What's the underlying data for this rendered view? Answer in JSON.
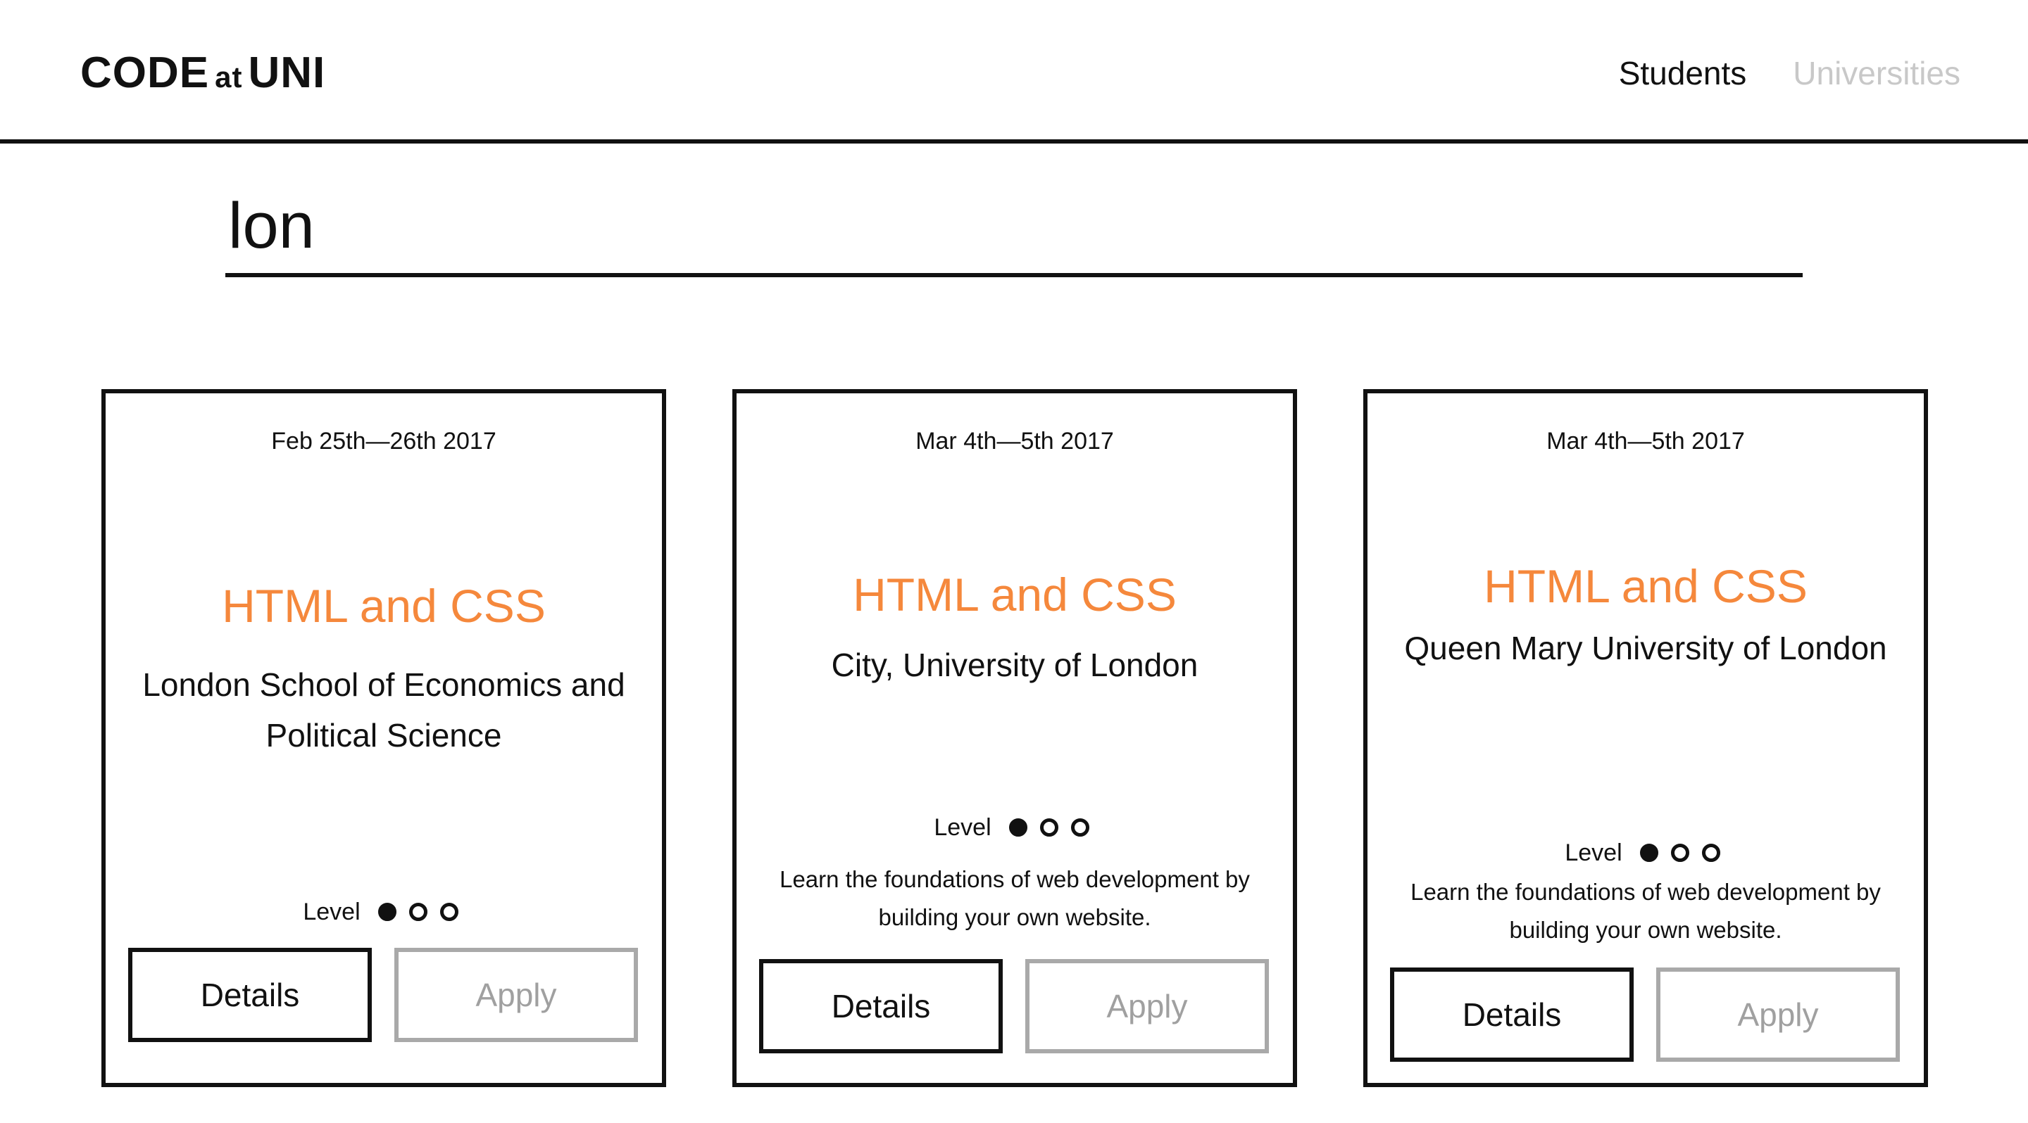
{
  "header": {
    "logo_code": "CODE",
    "logo_at": "at",
    "logo_uni": "UNI",
    "nav": [
      {
        "label": "Students",
        "active": true
      },
      {
        "label": "Universities",
        "active": false
      }
    ]
  },
  "search": {
    "value": "lon"
  },
  "level_label": "Level",
  "cards": [
    {
      "date": "Feb 25th—26th 2017",
      "title": "HTML and CSS",
      "university": "London School of Economics and Political Science",
      "level": 1,
      "level_max": 3,
      "description": "",
      "details_label": "Details",
      "apply_label": "Apply"
    },
    {
      "date": "Mar 4th—5th 2017",
      "title": "HTML and CSS",
      "university": "City, University of London",
      "level": 1,
      "level_max": 3,
      "description": "Learn the foundations of web development by building your own website.",
      "details_label": "Details",
      "apply_label": "Apply"
    },
    {
      "date": "Mar 4th—5th 2017",
      "title": "HTML and CSS",
      "university": "Queen Mary University of London",
      "level": 1,
      "level_max": 3,
      "description": "Learn the foundations of web development by building your own website.",
      "details_label": "Details",
      "apply_label": "Apply"
    }
  ],
  "colors": {
    "accent": "#f5883c",
    "text": "#111111",
    "inactive": "#c8c8c8",
    "disabled_border": "#a9a9a9"
  }
}
